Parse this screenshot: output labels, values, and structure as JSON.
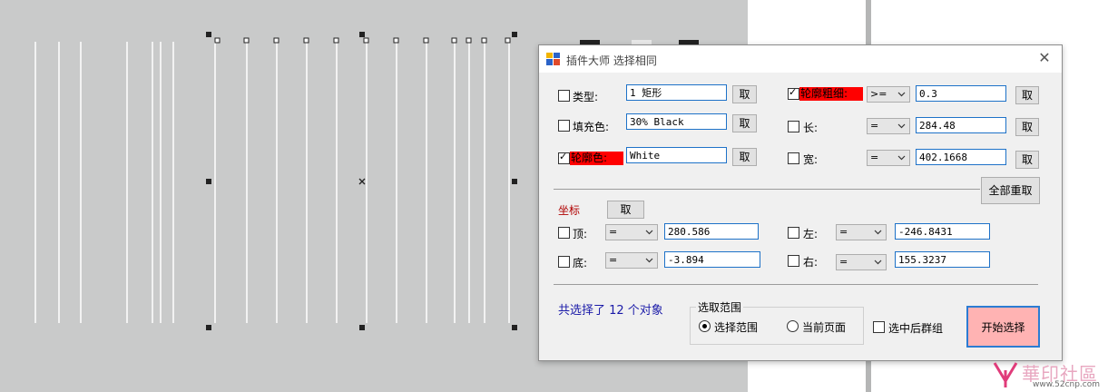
{
  "dialog": {
    "title": "插件大师 选择相同",
    "close_icon": "close-icon",
    "type_label": "类型:",
    "type_value": "1 矩形",
    "fill_label": "填充色:",
    "fill_value": "30% Black",
    "outline_color_label": "轮廓色:",
    "outline_color_value": "White",
    "outline_width_label": "轮廓粗细:",
    "outline_width_op": ">=",
    "outline_width_value": "0.3",
    "length_label": "长:",
    "length_op": "=",
    "length_value": "284.48",
    "width_label": "宽:",
    "width_op": "=",
    "width_value": "402.1668",
    "get_label": "取",
    "reset_all_label": "全部重取",
    "coords_label": "坐标",
    "top_label": "顶:",
    "top_op": "=",
    "top_value": "280.586",
    "bottom_label": "底:",
    "bottom_op": "=",
    "bottom_value": "-3.894",
    "left_label": "左:",
    "left_op": "=",
    "left_value": "-246.8431",
    "right_label": "右:",
    "right_op": "=",
    "right_value": "155.3237",
    "selected_text": "共选择了 12 个对象",
    "range_group_label": "选取范围",
    "range_option_selection": "选择范围",
    "range_option_page": "当前页面",
    "group_after_label": "选中后群组",
    "start_button_label": "开始选择",
    "checked": {
      "type": false,
      "fill": false,
      "outline_color": true,
      "outline_width": true,
      "length": false,
      "width": false,
      "top": false,
      "bottom": false,
      "left": false,
      "right": false,
      "group_after": false
    },
    "range_selected": "selection"
  },
  "colors": {
    "highlight_red": "#ff0000",
    "start_button_bg": "#ffb3b3",
    "start_button_border": "#2b7cd3",
    "selected_text_color": "#1a1aa8",
    "coords_label_color": "#b00000"
  },
  "watermark": {
    "logo_text": "華印社區",
    "url": "www.52cnp.com"
  }
}
